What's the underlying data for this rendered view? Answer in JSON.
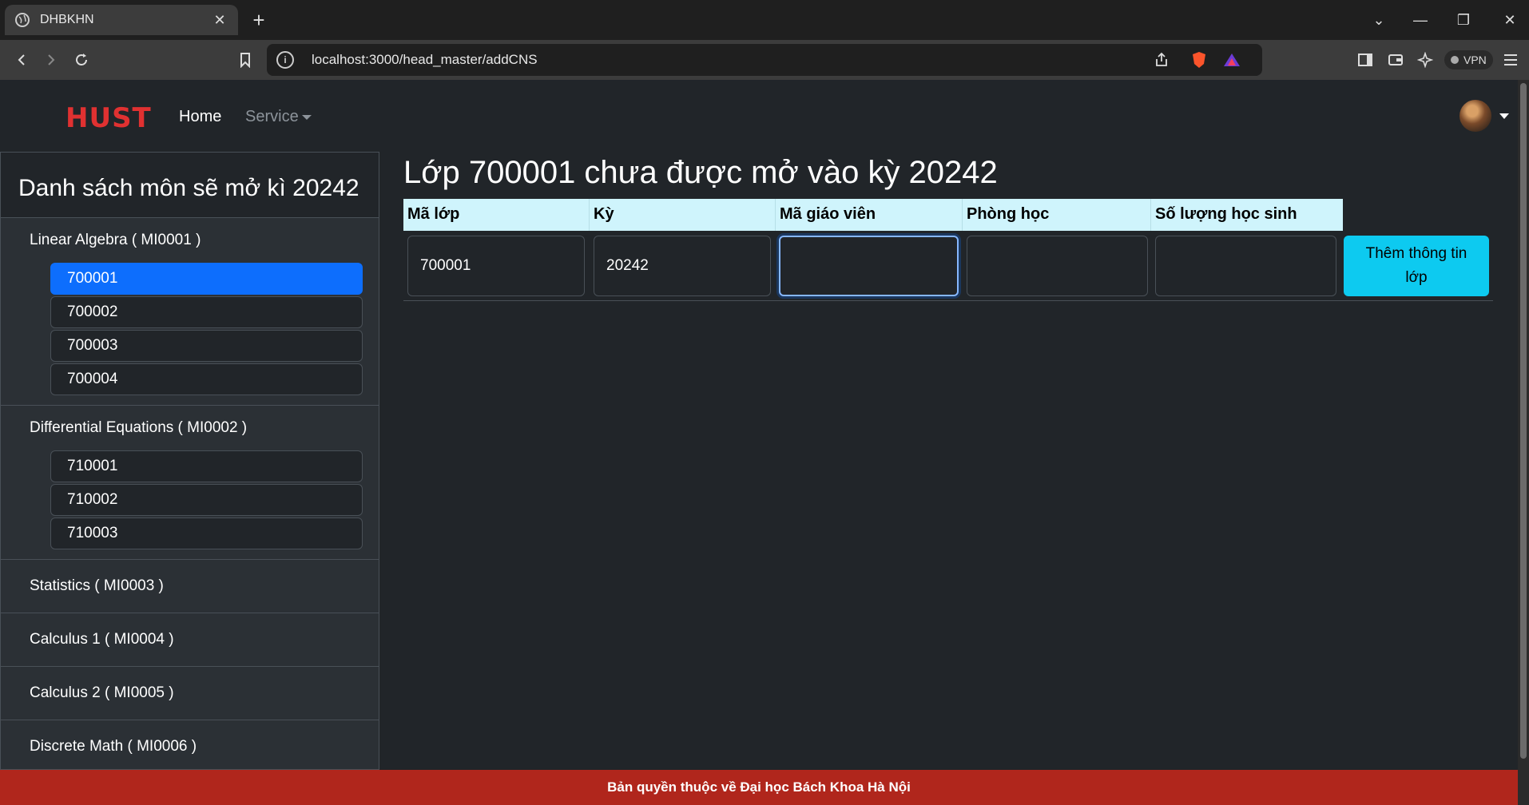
{
  "browser": {
    "tab_title": "DHBKHN",
    "url": "localhost:3000/head_master/addCNS",
    "vpn_label": "VPN"
  },
  "navbar": {
    "logo": "HUST",
    "home": "Home",
    "service": "Service"
  },
  "sidebar": {
    "title": "Danh sách môn sẽ mở kì 20242",
    "subjects": [
      {
        "label": "Linear Algebra ( MI0001 )",
        "classes": [
          "700001",
          "700002",
          "700003",
          "700004"
        ],
        "active": "700001"
      },
      {
        "label": "Differential Equations ( MI0002 )",
        "classes": [
          "710001",
          "710002",
          "710003"
        ]
      },
      {
        "label": "Statistics ( MI0003 )"
      },
      {
        "label": "Calculus 1 ( MI0004 )"
      },
      {
        "label": "Calculus 2 ( MI0005 )"
      },
      {
        "label": "Discrete Math ( MI0006 )"
      }
    ]
  },
  "main": {
    "title": "Lớp 700001 chưa được mở vào kỳ 20242",
    "columns": [
      "Mã lớp",
      "Kỳ",
      "Mã giáo viên",
      "Phòng học",
      "Số lượng học sinh"
    ],
    "row": {
      "class_code": "700001",
      "term": "20242",
      "teacher_code": "",
      "room": "",
      "student_count": ""
    },
    "add_button": "Thêm thông tin lớp"
  },
  "footer": {
    "text": "Bản quyền thuộc về Đại học Bách Khoa Hà Nội"
  },
  "colors": {
    "active_item": "#0d6efd",
    "header_cell": "#cff4fc",
    "button": "#0dcaf0",
    "footer": "#b0261c",
    "logo": "#e03131"
  }
}
